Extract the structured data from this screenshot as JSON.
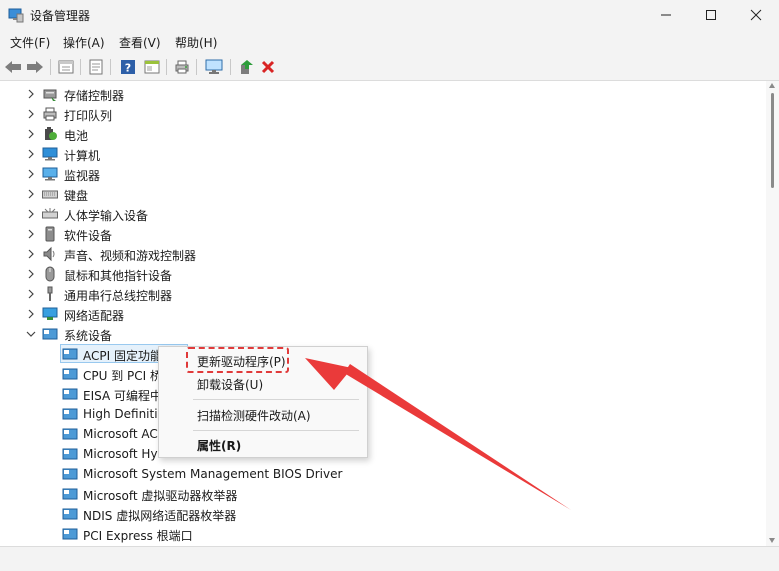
{
  "window": {
    "title": "设备管理器",
    "controls": [
      "minimize",
      "maximize",
      "close"
    ]
  },
  "menubar": {
    "items": [
      "文件(F)",
      "操作(A)",
      "查看(V)",
      "帮助(H)"
    ]
  },
  "toolbar": {
    "buttons": [
      "back-icon",
      "forward-icon",
      "properties-view-icon",
      "device-sheet-icon",
      "help-icon",
      "panel-icon",
      "print-icon",
      "monitor-icon",
      "update-driver-icon",
      "uninstall-icon"
    ]
  },
  "tree": {
    "categories": [
      {
        "label": "存储控制器",
        "icon": "storage-controller-icon"
      },
      {
        "label": "打印队列",
        "icon": "printer-icon"
      },
      {
        "label": "电池",
        "icon": "battery-icon"
      },
      {
        "label": "计算机",
        "icon": "computer-icon"
      },
      {
        "label": "监视器",
        "icon": "monitor-icon"
      },
      {
        "label": "键盘",
        "icon": "keyboard-icon"
      },
      {
        "label": "人体学输入设备",
        "icon": "hid-icon"
      },
      {
        "label": "软件设备",
        "icon": "software-device-icon"
      },
      {
        "label": "声音、视频和游戏控制器",
        "icon": "audio-icon"
      },
      {
        "label": "鼠标和其他指针设备",
        "icon": "mouse-icon"
      },
      {
        "label": "通用串行总线控制器",
        "icon": "usb-icon"
      },
      {
        "label": "网络适配器",
        "icon": "network-adapter-icon"
      },
      {
        "label": "系统设备",
        "icon": "system-device-icon",
        "expanded": true
      }
    ],
    "children": [
      {
        "label": "ACPI 固定功能",
        "selected": true
      },
      {
        "label": "CPU 到 PCI 桥"
      },
      {
        "label": "EISA 可编程中"
      },
      {
        "label": "High Definitio"
      },
      {
        "label": "Microsoft AC"
      },
      {
        "label": "Microsoft Hy"
      },
      {
        "label": "Microsoft System Management BIOS Driver"
      },
      {
        "label": "Microsoft 虚拟驱动器枚举器"
      },
      {
        "label": "NDIS 虚拟网络适配器枚举器"
      },
      {
        "label": "PCI Express 根端口"
      }
    ]
  },
  "context_menu": {
    "items": [
      {
        "label": "更新驱动程序(P)",
        "highlighted": true
      },
      {
        "label": "卸载设备(U)"
      },
      {
        "label": "扫描检测硬件改动(A)"
      },
      {
        "label": "属性(R)",
        "bold": true
      }
    ]
  },
  "colors": {
    "annotation_red": "#e03a3a",
    "selection": "#e5f1fb",
    "monitor_blue": "#2f8fd8"
  }
}
